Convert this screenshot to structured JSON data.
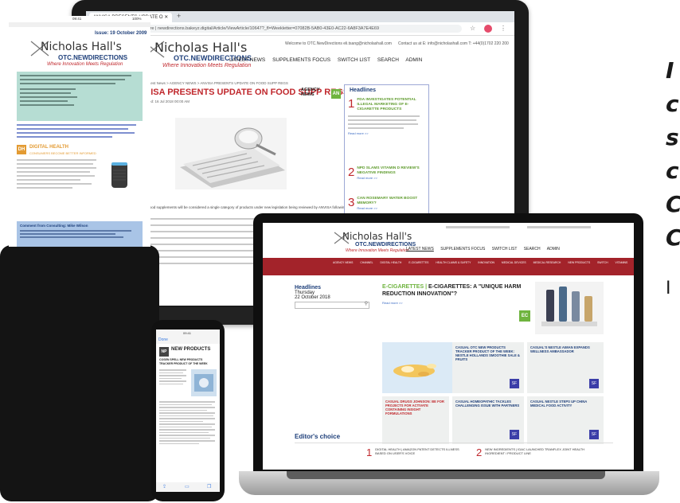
{
  "monitor": {
    "tab_title": "ANVISA PRESENTS UPDATE O",
    "url": "Not Secure | newdirections.bakeyz.digital/Article/ViewArticle/10647?_fl=Weekletter=07082B-5AB0-43E0-AC22-6A8F3A7E4E69",
    "logo_name": "Nicholas Hall's",
    "logo_sub": "OTC.NEWDIRECTIONS",
    "logo_tag": "Where Innovation Meets Regulation",
    "welcome": "Welcome to OTC.NewDirections eli.tsang@nicholashall.com",
    "contact": "Contact us at E: info@nicholashall.com  T: +44(0)1702 220 200",
    "menu": [
      "LATEST NEWS",
      "SUPPLEMENTS FOCUS",
      "SWITCH LIST",
      "SEARCH",
      "ADMIN"
    ],
    "breadcrumb": "Home > Latest News > AGENCY NEWS > ANVISA PRESENTS UPDATE ON FOOD SUPP REGS",
    "headline": "ANVISA PRESENTS UPDATE ON FOOD SUPP REGS",
    "date": "Last updated: 16 Jul 2018 00:00 AM",
    "category": "AGENCY NEWS",
    "badge": "AN",
    "sidebar_title": "Headlines",
    "headlines": [
      {
        "num": "1",
        "title": "FDA INVESTIGATES POTENTIAL ILLEGAL MARKETING OF E-CIGARETTE PRODUCTS",
        "read": "Read more >>"
      },
      {
        "num": "2",
        "title": "NPD SLAMS VITAMIN D REVIEW'S NEGATIVE FINDINGS",
        "read": "Read more >>"
      },
      {
        "num": "3",
        "title": "CAN ROSEMARY WATER BOOST MEMORY?",
        "read": "Read more >>"
      }
    ],
    "body_lead": "ANVISA: Food supplements will be considered a single category of products under new legislation being reviewed by ANVISA following public consultations between January-April."
  },
  "tablet": {
    "status_time": "09:41",
    "status_battery": "100%",
    "issue": "Issue: 19 October 2009",
    "logo_name": "Nicholas Hall's",
    "logo_sub": "OTC.NEWDIRECTIONS",
    "logo_tag": "Where Innovation Meets Regulation",
    "section_badge": "DH",
    "section_title": "DIGITAL HEALTH",
    "section_sub": "CONSUMERS BECOME BETTER INFORMED",
    "footer": "Comment from Consulting: Mike Wilson"
  },
  "phone": {
    "status_time": "09:41",
    "back": "Done",
    "badge": "NP",
    "title": "NEW PRODUCTS",
    "subtitle": "COSEN SPELL NEW PRODUCTS TRACKER PRODUCT OF THE WEEK"
  },
  "laptop": {
    "logo_name": "Nicholas Hall's",
    "logo_sub": "OTC.NEWDIRECTIONS",
    "logo_tag": "Where Innovation Meets Regulation",
    "menu": [
      "LATEST NEWS",
      "SUPPLEMENTS FOCUS",
      "SWITCH LIST",
      "SEARCH",
      "ADMIN"
    ],
    "redbar": [
      "AGENCY NEWS",
      "CHANNEL",
      "DIGITAL HEALTH",
      "E-CIGARETTES",
      "HEALTH CLAIMS & SAFETY",
      "INNOVATION",
      "MEDICAL DEVICES",
      "MEDICAL RESEARCH",
      "NEW PRODUCTS",
      "SWITCH",
      "VITAMINS"
    ],
    "sidebar_title": "Headlines",
    "sidebar_day": "Thursday",
    "sidebar_date": "22 October 2018",
    "feature_tag": "E-CIGARETTES",
    "feature_title": "E-CIGARETTES: A \"UNIQUE HARM REDUCTION INNOVATION\"?",
    "feature_read": "Read more >>",
    "feature_badge": "EC",
    "tiles": [
      {
        "title": "CASUAL OTC NEW PRODUCTS TRACKER PRODUCT OF THE WEEK: NESTLE HOLLANDS SMOOTHIE SALE & FRUITS",
        "color": "#1e3f7a"
      },
      {
        "title": "CASUAL'S NESTLE AIMAN EXPANDS WELLNESS AMBASSADOR",
        "color": "#1e3f7a"
      },
      {
        "title": "CASUAL DRUGS JOHNSON: BE FOR PROJECTS FOR ACTIVATE CONTAINING INSIGHT FORMULATIONS",
        "color": "#c0282d"
      },
      {
        "title": "CASUAL HOMEOPATHIC TACKLES CHALLENGING ISSUE WITH PARTNERS",
        "color": "#1e3f7a"
      },
      {
        "title": "CASUAL NESTLE STEPS UP CHINA MEDICAL FOOD ACTIVITY",
        "color": "#1e3f7a"
      }
    ],
    "tile_badge": "SF",
    "editors_choice": "Editor's choice",
    "choices": [
      {
        "num": "1",
        "title": "DIGITAL HEALTH | AMAZON PATENT DETECTS ILLNESS BASED ON USER'S VOICE"
      },
      {
        "num": "2",
        "title": "NEW INGREDIENTS | IDAC LAUNCHED TRANFLEX JOINT HEALTH INGREDIENT / PRODUCT LINE"
      }
    ]
  },
  "right_text": [
    "I",
    "c",
    "s",
    "c",
    "C",
    "C",
    "I"
  ]
}
